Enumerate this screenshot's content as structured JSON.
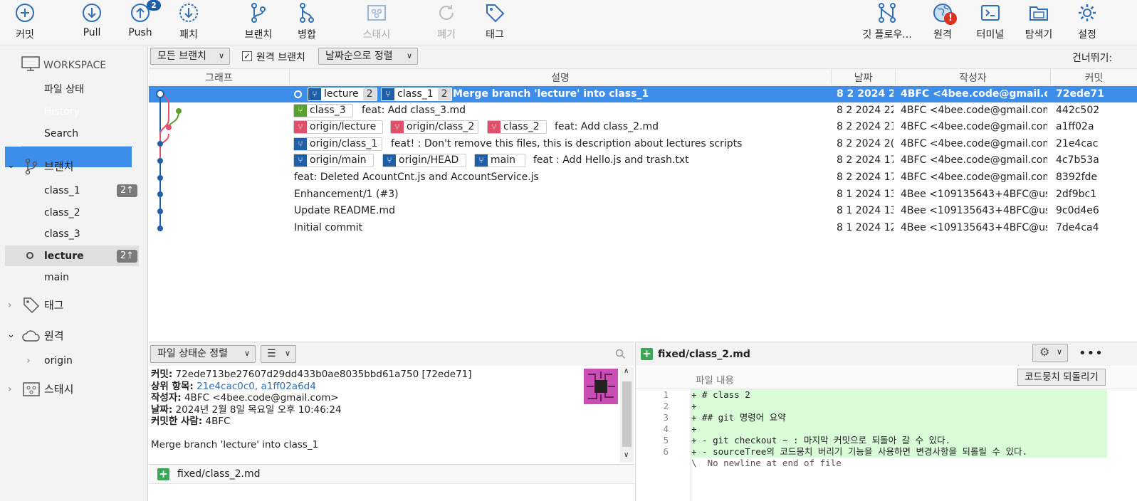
{
  "toolbar": {
    "commit": "커밋",
    "pull": "Pull",
    "push": "Push",
    "push_badge": "2",
    "patch": "패치",
    "branch": "브랜치",
    "merge": "병합",
    "stash": "스태시",
    "discard": "폐기",
    "tag": "태그",
    "gitflow": "깃 플로우...",
    "remote": "원격",
    "remote_alert": "!",
    "terminal": "터미널",
    "explorer": "탐색기",
    "settings": "설정"
  },
  "sidebar": {
    "workspace": "WORKSPACE",
    "file_status": "파일 상태",
    "history": "History",
    "search": "Search",
    "branches_title": "브랜치",
    "branches": [
      {
        "name": "class_1",
        "ahead": "2↑"
      },
      {
        "name": "class_2"
      },
      {
        "name": "class_3"
      },
      {
        "name": "lecture",
        "ahead": "2↑"
      },
      {
        "name": "main"
      }
    ],
    "tags_title": "태그",
    "remotes_title": "원격",
    "origin": "origin",
    "stash_title": "스태시"
  },
  "filter": {
    "branches": "모든 브랜치",
    "remote_branches": "원격 브랜치",
    "sort": "날짜순으로 정렬",
    "skip": "건너뛰기:"
  },
  "columns": {
    "graph": "그래프",
    "desc": "설명",
    "date": "날짜",
    "author": "작성자",
    "commit": "커밋"
  },
  "commits": [
    {
      "msg": "Merge branch 'lecture' into class_1",
      "date": "8 2 2024 2",
      "author": "4BFC <4bee.code@gmail.con",
      "hash": "72ede71"
    },
    {
      "msg": "feat: Add class_3.md",
      "date": "8 2 2024 22",
      "author": "4BFC <4bee.code@gmail.com:",
      "hash": "442c502"
    },
    {
      "msg": "feat: Add class_2.md",
      "date": "8 2 2024 21",
      "author": "4BFC <4bee.code@gmail.com:",
      "hash": "a1ff02a"
    },
    {
      "msg": "feat! : Don't remove this files, this is description about lectures scripts",
      "date": "8 2 2024 2(",
      "author": "4BFC <4bee.code@gmail.com:",
      "hash": "21e4cac"
    },
    {
      "msg": "feat : Add Hello.js and trash.txt",
      "date": "8 2 2024 17",
      "author": "4BFC <4bee.code@gmail.com:",
      "hash": "4c7b53a"
    },
    {
      "msg": "feat: Deleted AcountCnt.js and AccountService.js",
      "date": "8 2 2024 17",
      "author": "4BFC <4bee.code@gmail.com:",
      "hash": "8392fde"
    },
    {
      "msg": "Enhancement/1 (#3)",
      "date": "8 1 2024 13",
      "author": "4Bee <109135643+4BFC@usel",
      "hash": "2df9bc1"
    },
    {
      "msg": "Update README.md",
      "date": "8 1 2024 13",
      "author": "4Bee <109135643+4BFC@usel",
      "hash": "9c0d4e6"
    },
    {
      "msg": "Initial commit",
      "date": "8 1 2024 12",
      "author": "4Bee <109135643+4BFC@usel",
      "hash": "7de4ca4"
    }
  ],
  "refs": {
    "lecture": "lecture",
    "lecture_n": "2",
    "class_1": "class_1",
    "class_1_n": "2",
    "class_3": "class_3",
    "origin_lecture": "origin/lecture",
    "origin_class_2": "origin/class_2",
    "class_2": "class_2",
    "origin_class_1": "origin/class_1",
    "origin_main": "origin/main",
    "origin_head": "origin/HEAD",
    "main": "main"
  },
  "details": {
    "sort": "파일 상태순 정렬",
    "commit_label": "커밋:",
    "commit_value": "72ede713be27607d29dd433b0ae8035bbd61a750 [72ede71]",
    "parents_label": "상위 항목:",
    "parents_value": "21e4cac0c0, a1ff02a6d4",
    "author_label": "작성자:",
    "author_value": "4BFC <4bee.code@gmail.com>",
    "date_label": "날짜:",
    "date_value": "2024년 2월 8일 목요일 오후 10:46:24",
    "committer_label": "커밋한 사람:",
    "committer_value": "4BFC",
    "message": "Merge branch 'lecture' into class_1",
    "file": "fixed/class_2.md"
  },
  "diff": {
    "file": "fixed/class_2.md",
    "content_label": "파일 내용",
    "revert_button": "코드뭉치 되돌리기",
    "lines": [
      {
        "n": "1",
        "text": "+ # class 2"
      },
      {
        "n": "2",
        "text": "+"
      },
      {
        "n": "3",
        "text": "+ ## git 명령어 요약"
      },
      {
        "n": "4",
        "text": "+"
      },
      {
        "n": "5",
        "text": "+ - git checkout ~ : 마지막 커밋으로 되돌아 갈 수 있다."
      },
      {
        "n": "6",
        "text": "+ - sourceTree의 코드뭉치 버리기 기능을 사용하면 변경사항을 되롤릴 수 있다."
      }
    ],
    "no_newline": "\\  No newline at end of file"
  },
  "colors": {
    "selection": "#3d8eea",
    "graph_blue": "#1f5fa8",
    "graph_red": "#e0506b",
    "graph_green": "#5aa02c",
    "added_bg": "#d9fbd8"
  }
}
